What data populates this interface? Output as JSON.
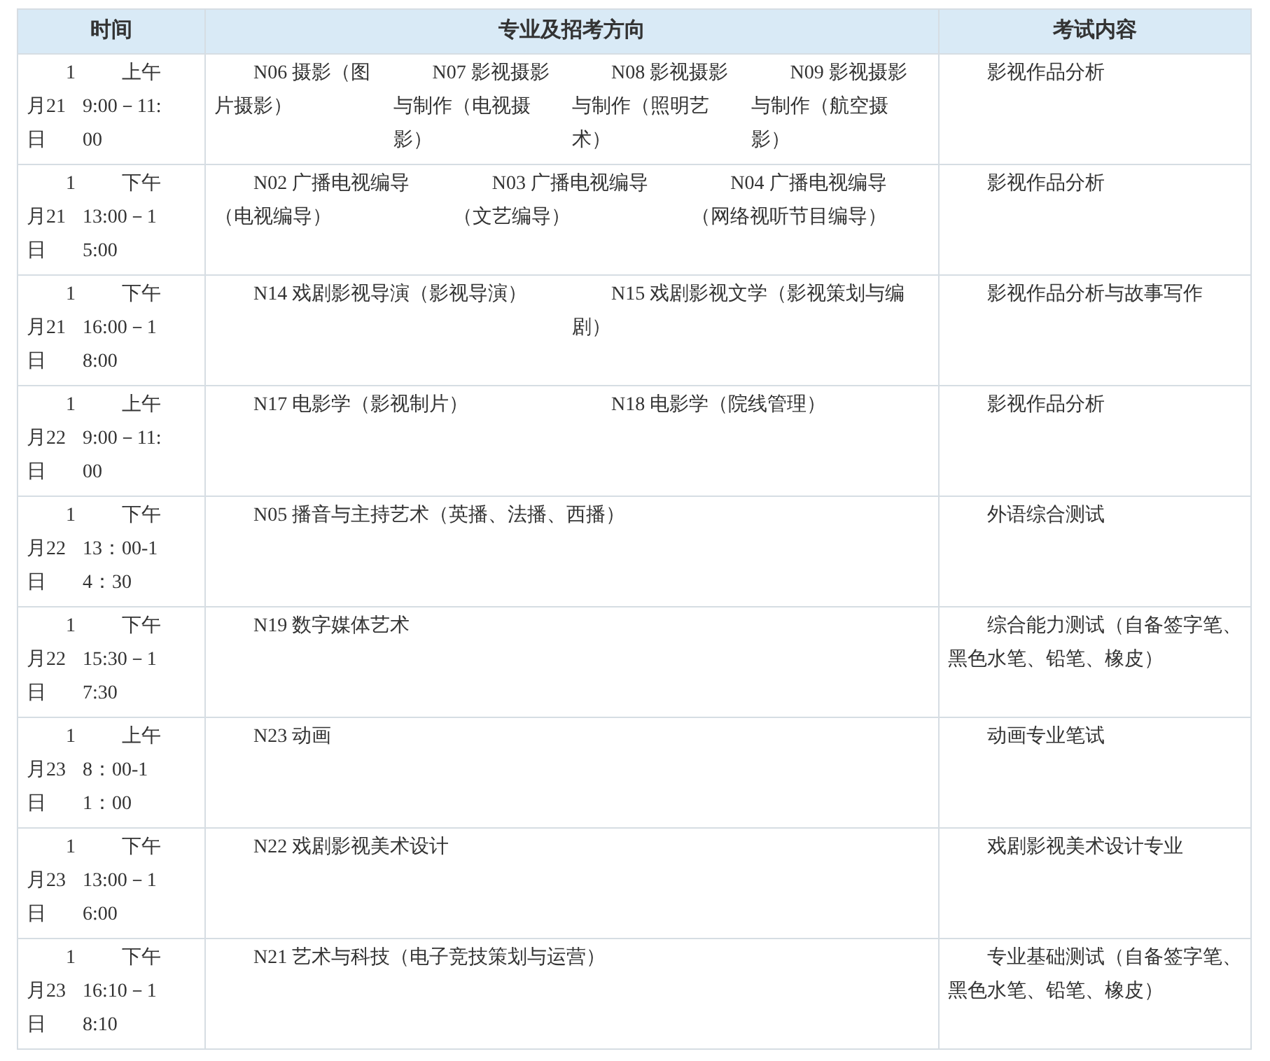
{
  "table": {
    "columns": [
      "时间",
      "专业及招考方向",
      "考试内容"
    ],
    "rows": [
      {
        "date": "1月21日",
        "time": "上午9:00－11:00",
        "majors": [
          "N06 摄影（图片摄影）",
          "N07 影视摄影与制作（电视摄影）",
          "N08 影视摄影与制作（照明艺术）",
          "N09 影视摄影与制作（航空摄影）"
        ],
        "content": "影视作品分析"
      },
      {
        "date": "1月21日",
        "time": "下午13:00－15:00",
        "majors": [
          "N02 广播电视编导（电视编导）",
          "N03 广播电视编导（文艺编导）",
          "N04 广播电视编导（网络视听节目编导）"
        ],
        "content": "影视作品分析"
      },
      {
        "date": "1月21日",
        "time": "下午16:00－18:00",
        "majors": [
          "N14 戏剧影视导演（影视导演）",
          "N15 戏剧影视文学（影视策划与编剧）"
        ],
        "content": "影视作品分析与故事写作"
      },
      {
        "date": "1月22日",
        "time": "上午9:00－11:00",
        "majors": [
          "N17 电影学（影视制片）",
          "N18 电影学（院线管理）"
        ],
        "content": "影视作品分析"
      },
      {
        "date": "1月22日",
        "time": "下午13：00-14：30",
        "majors": [
          "N05 播音与主持艺术（英播、法播、西播）"
        ],
        "content": "外语综合测试"
      },
      {
        "date": "1月22日",
        "time": "下午15:30－17:30",
        "majors": [
          "N19 数字媒体艺术"
        ],
        "content": "综合能力测试（自备签字笔、黑色水笔、铅笔、橡皮）"
      },
      {
        "date": "1月23日",
        "time": "上午8：00-11：00",
        "majors": [
          "N23 动画"
        ],
        "content": "动画专业笔试"
      },
      {
        "date": "1月23日",
        "time": "下午13:00－16:00",
        "majors": [
          "N22 戏剧影视美术设计"
        ],
        "content": "戏剧影视美术设计专业"
      },
      {
        "date": "1月23日",
        "time": "下午16:10－18:10",
        "majors": [
          "N21 艺术与科技（电子竞技策划与运营）"
        ],
        "content": "专业基础测试（自备签字笔、黑色水笔、铅笔、橡皮）"
      }
    ]
  }
}
